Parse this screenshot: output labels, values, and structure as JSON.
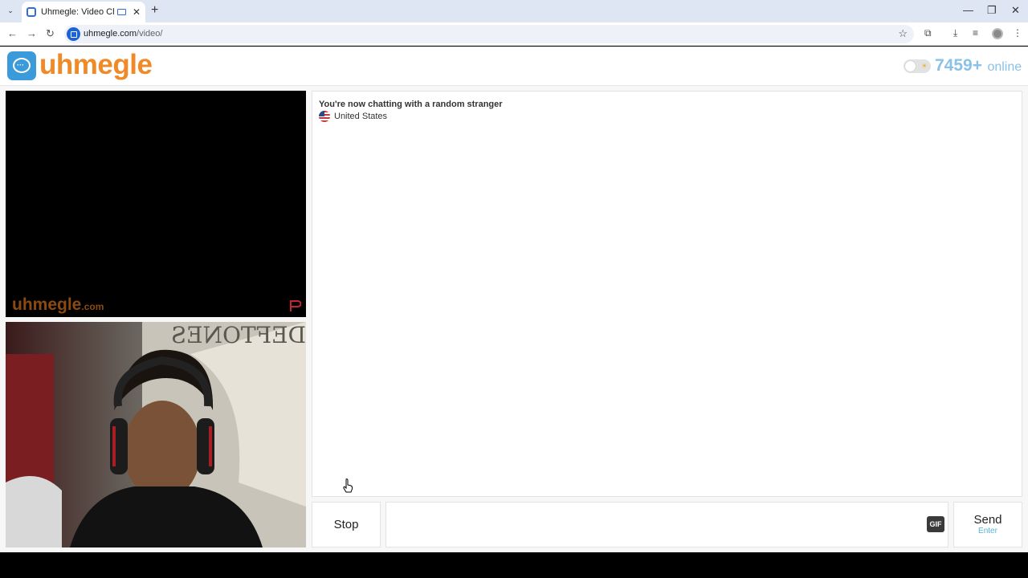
{
  "browser": {
    "tab_title": "Uhmegle: Video Chat | Random",
    "new_tab": "+",
    "url_host": "uhmegle.com",
    "url_path": "/video/"
  },
  "header": {
    "logo_text": "uhmegle",
    "online_count": "7459+",
    "online_label": "online"
  },
  "remote_video": {
    "watermark": "uhmegle",
    "watermark_domain": ".com"
  },
  "chat": {
    "status": "You're now chatting with a random stranger",
    "country": "United States"
  },
  "controls": {
    "stop_label": "Stop",
    "gif_label": "GIF",
    "send_label": "Send",
    "send_hint": "Enter",
    "message_placeholder": ""
  },
  "colors": {
    "brand_orange": "#f08a28",
    "brand_blue": "#3b9ad9",
    "online_blue": "#89c1e8"
  }
}
